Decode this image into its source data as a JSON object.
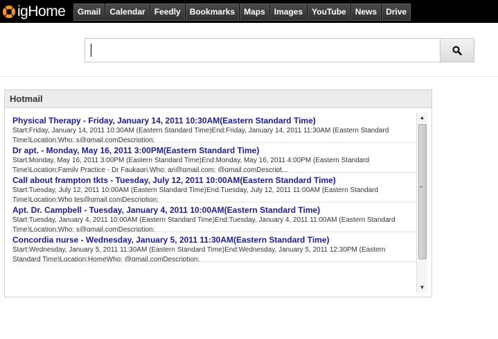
{
  "logo": {
    "text": "igHome",
    "icon": "ighome-ring-logo"
  },
  "nav": [
    {
      "label": "Gmail"
    },
    {
      "label": "Calendar"
    },
    {
      "label": "Feedly"
    },
    {
      "label": "Bookmarks"
    },
    {
      "label": "Maps"
    },
    {
      "label": "Images"
    },
    {
      "label": "YouTube"
    },
    {
      "label": "News"
    },
    {
      "label": "Drive"
    }
  ],
  "search": {
    "value": "",
    "button_icon": "search-icon"
  },
  "widget": {
    "title": "Hotmail",
    "items": [
      {
        "title": "Physical Therapy - Friday, January 14, 2011 10:30AM(Eastern Standard Time)",
        "desc": "Start:Friday, January 14, 2011 10:30AM (Eastern Standard Time)End:Friday, January 14, 2011 11:30AM (Eastern Standard Time)Location:Who:       s@gmail.comDescription:"
      },
      {
        "title": "Dr apt. - Monday, May 16, 2011 3:00PM(Eastern Standard Time)",
        "desc": "Start:Monday, May 16, 2011 3:00PM (Eastern Standard Time)End:Monday, May 16, 2011 4:00PM (Eastern Standard Time)Location:Family Practice - Dr Faukaqri.Who:       ari@gmail.com;        @gmail.comDescript..."
      },
      {
        "title": "Call about frampton tkts - Tuesday, July 12, 2011 10:00AM(Eastern Standard Time)",
        "desc": "Start:Tuesday, July 12, 2011 10:00AM (Eastern Standard Time)End:Tuesday, July 12, 2011 11:00AM (Eastern Standard Time)Location:Who       tes@gmail.comDescription:"
      },
      {
        "title": "Apt. Dr. Campbell - Tuesday, January 4, 2011 10:00AM(Eastern Standard Time)",
        "desc": "Start:Tuesday, January 4, 2011 10:00AM (Eastern Standard Time)End:Tuesday, January 4, 2011 11:00AM (Eastern Standard Time)Location:Who:        s@gmail.comDescription:"
      },
      {
        "title": "Concordia nurse - Wednesday, January 5, 2011 11:30AM(Eastern Standard Time)",
        "desc": "Start:Wednesday, January 5, 2011 11:30AM (Eastern Standard Time)End:Wednesday, January 5, 2011 12:30PM (Eastern Standard Time)Location:HomeWho:         @gmail.comDescription:"
      }
    ]
  },
  "scrollbar": {
    "up_icon": "arrow-up-icon",
    "down_icon": "arrow-down-icon"
  }
}
